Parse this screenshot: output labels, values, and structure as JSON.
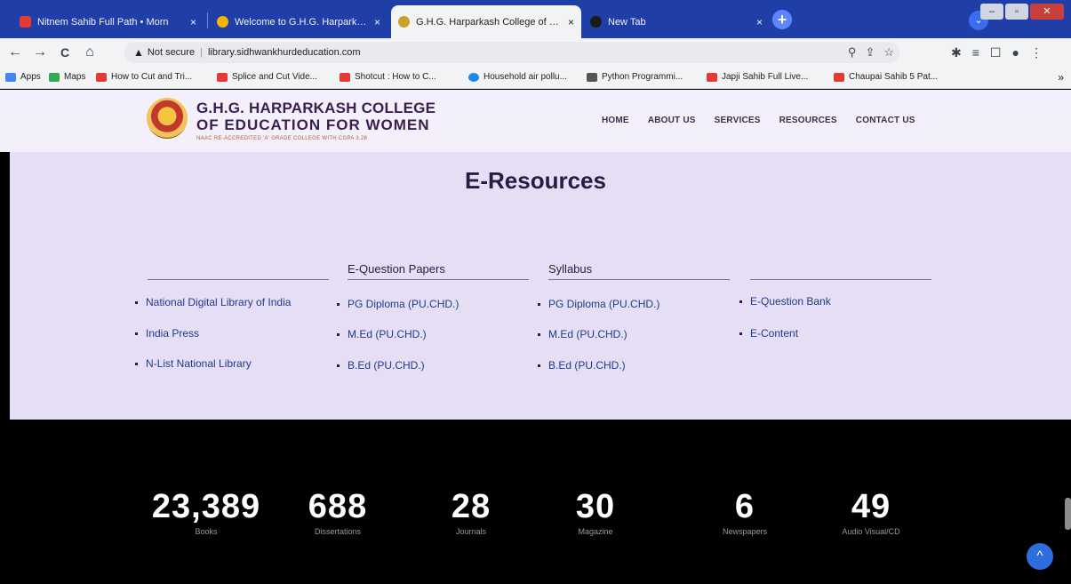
{
  "browser": {
    "tabs": [
      {
        "title": "Nitnem Sahib Full Path • Morn",
        "close": "×",
        "icon_color": "#e53935"
      },
      {
        "title": "Welcome to G.H.G. Harparkash",
        "close": "×",
        "icon_color": "#f4b400"
      },
      {
        "title": "G.H.G. Harparkash College of Edu",
        "close": "×",
        "icon_color": "#c9a227"
      },
      {
        "title": "New Tab",
        "close": "×",
        "icon_color": "#1a1a1a"
      }
    ],
    "new_tab_symbol": "+",
    "profile_symbol": "⌄",
    "window_controls": {
      "minimize": "–",
      "restore": "▫",
      "close": "✕"
    },
    "nav": {
      "back": "←",
      "forward": "→",
      "reload": "C",
      "home": "⌂"
    },
    "address": {
      "warning_icon": "▲",
      "security_label": "Not secure",
      "separator": "|",
      "url": "library.sidhwankhurdeducation.com"
    },
    "address_icons": {
      "zoom": "⚲",
      "share": "⇪",
      "star": "☆"
    },
    "toolbar_icons": {
      "extensions": "✱",
      "reading_list": "≡",
      "side_panel": "☐",
      "profile": "●",
      "menu": "⋮"
    },
    "bookmarks": [
      {
        "label": "Apps",
        "icon_color": "#4285f4"
      },
      {
        "label": "Maps",
        "icon_color": "#34a853"
      },
      {
        "label": "How to Cut and Tri...",
        "icon_color": "#e53935"
      },
      {
        "label": "Splice and Cut Vide...",
        "icon_color": "#e53935"
      },
      {
        "label": "Shotcut : How to C...",
        "icon_color": "#e53935"
      },
      {
        "label": "Household air pollu...",
        "icon_color": "#1e88e5"
      },
      {
        "label": "Python Programmi...",
        "icon_color": "#555555"
      },
      {
        "label": "Japji Sahib Full Live...",
        "icon_color": "#e53935"
      },
      {
        "label": "Chaupai Sahib 5 Pat...",
        "icon_color": "#e53935"
      }
    ],
    "bookmarks_more": "»"
  },
  "site": {
    "logo_line1": "G.H.G. HARPARKASH COLLEGE",
    "logo_line2": "OF EDUCATION FOR WOMEN",
    "logo_tagline": "NAAC RE-ACCREDITED 'A' GRADE COLLEGE WITH CGPA 3.28",
    "nav": [
      "HOME",
      "ABOUT US",
      "SERVICES",
      "RESOURCES",
      "CONTACT US"
    ]
  },
  "page": {
    "heading": "E-Resources",
    "columns": [
      {
        "header": "",
        "items": [
          "National Digital Library of India",
          "India Press",
          "N-List National Library"
        ]
      },
      {
        "header": "E-Question Papers",
        "items": [
          "PG Diploma (PU.CHD.)",
          "M.Ed (PU.CHD.)",
          "B.Ed (PU.CHD.)"
        ]
      },
      {
        "header": "Syllabus",
        "items": [
          "PG Diploma (PU.CHD.)",
          "M.Ed (PU.CHD.)",
          "B.Ed (PU.CHD.)"
        ]
      },
      {
        "header": "",
        "items": [
          "E-Question Bank",
          "E-Content"
        ]
      }
    ]
  },
  "stats": [
    {
      "value": "23,389",
      "label": "Books"
    },
    {
      "value": "688",
      "label": "Dissertations"
    },
    {
      "value": "28",
      "label": "Journals"
    },
    {
      "value": "30",
      "label": "Magazine"
    },
    {
      "value": "6",
      "label": "Newspapers"
    },
    {
      "value": "49",
      "label": "Audio Visual/CD"
    }
  ],
  "scroll_top_symbol": "^"
}
